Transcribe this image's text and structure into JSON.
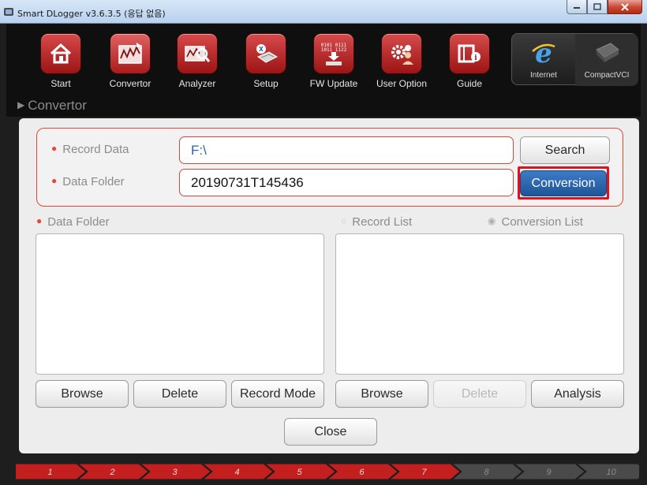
{
  "window": {
    "title": "Smart DLogger v3.6.3.5 (응답 없음)"
  },
  "toolbar": {
    "items": [
      {
        "label": "Start",
        "icon": "home-icon"
      },
      {
        "label": "Convertor",
        "icon": "convertor-icon"
      },
      {
        "label": "Analyzer",
        "icon": "analyzer-icon"
      },
      {
        "label": "Setup",
        "icon": "setup-icon"
      },
      {
        "label": "FW Update",
        "icon": "fw-update-icon"
      },
      {
        "label": "User Option",
        "icon": "user-option-icon"
      },
      {
        "label": "Guide",
        "icon": "guide-icon"
      }
    ],
    "links": [
      {
        "label": "Internet",
        "icon": "internet-explorer-icon"
      },
      {
        "label": "CompactVCI",
        "icon": "compactvci-icon"
      }
    ]
  },
  "breadcrumb": {
    "text": "Convertor"
  },
  "form": {
    "record_data_label": "Record Data",
    "record_data_value": "F:\\",
    "data_folder_label": "Data Folder",
    "data_folder_value": "20190731T145436",
    "search_label": "Search",
    "conversion_label": "Conversion"
  },
  "left_list": {
    "label": "Data Folder",
    "buttons": {
      "browse": "Browse",
      "delete": "Delete",
      "record_mode": "Record Mode"
    }
  },
  "right_list": {
    "record_list_label": "Record List",
    "conversion_list_label": "Conversion List",
    "selected": "Conversion List",
    "buttons": {
      "browse": "Browse",
      "delete": "Delete",
      "analysis": "Analysis"
    }
  },
  "close_label": "Close",
  "steps": {
    "labels": [
      "1",
      "2",
      "3",
      "4",
      "5",
      "6",
      "7",
      "8",
      "9",
      "10"
    ],
    "completed": 7
  },
  "colors": {
    "accent_red": "#e04a3a",
    "primary_blue": "#2a66b2",
    "highlight_red": "#e0101c"
  }
}
